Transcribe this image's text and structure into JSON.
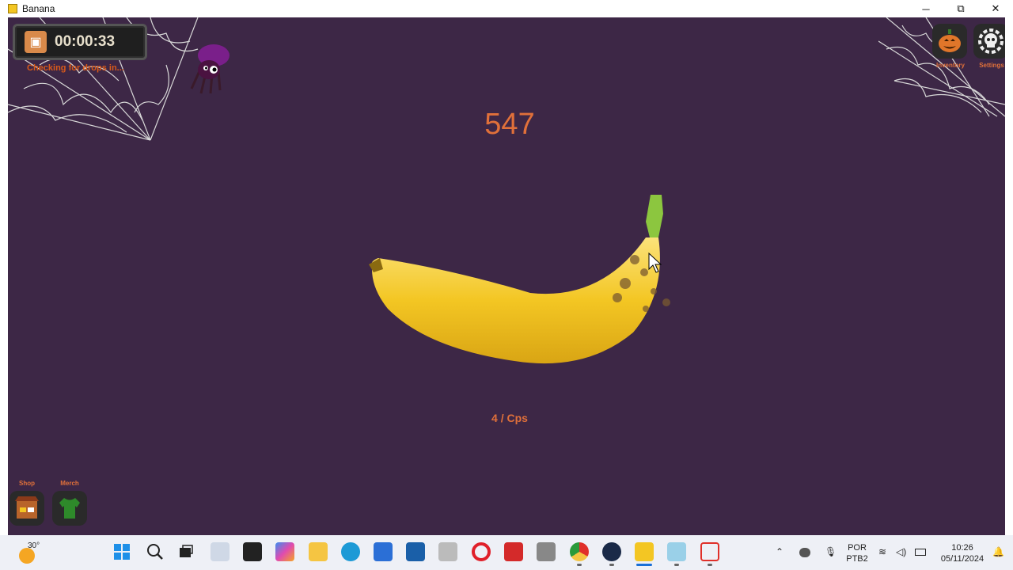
{
  "window": {
    "title": "Banana",
    "minimize": "─",
    "maximize": "⧉",
    "close": "✕"
  },
  "hud": {
    "timer": "00:00:33",
    "drops_status": "Checking for drops in...",
    "score": "547",
    "cps": "4 / Cps"
  },
  "corner_buttons": {
    "inventory_label": "Inventory",
    "settings_label": "Settings"
  },
  "bottom_buttons": {
    "shop_label": "Shop",
    "merch_label": "Merch"
  },
  "taskbar": {
    "weather_temp": "30°",
    "icons": [
      "windows-start-icon",
      "search-icon",
      "task-view-icon",
      "widgets-icon",
      "app-icon",
      "copilot-icon",
      "file-explorer-icon",
      "edge-icon",
      "store-icon",
      "app-icon",
      "app-icon",
      "opera-icon",
      "app-icon",
      "calculator-icon",
      "chrome-icon",
      "steam-icon",
      "banana-icon",
      "app-icon",
      "snipping-tool-icon"
    ],
    "language_line1": "POR",
    "language_line2": "PTB2",
    "time": "10:26",
    "date": "05/11/2024"
  },
  "colors": {
    "game_bg": "#3d2746",
    "accent": "#e0703a",
    "banana": "#f3c623"
  }
}
